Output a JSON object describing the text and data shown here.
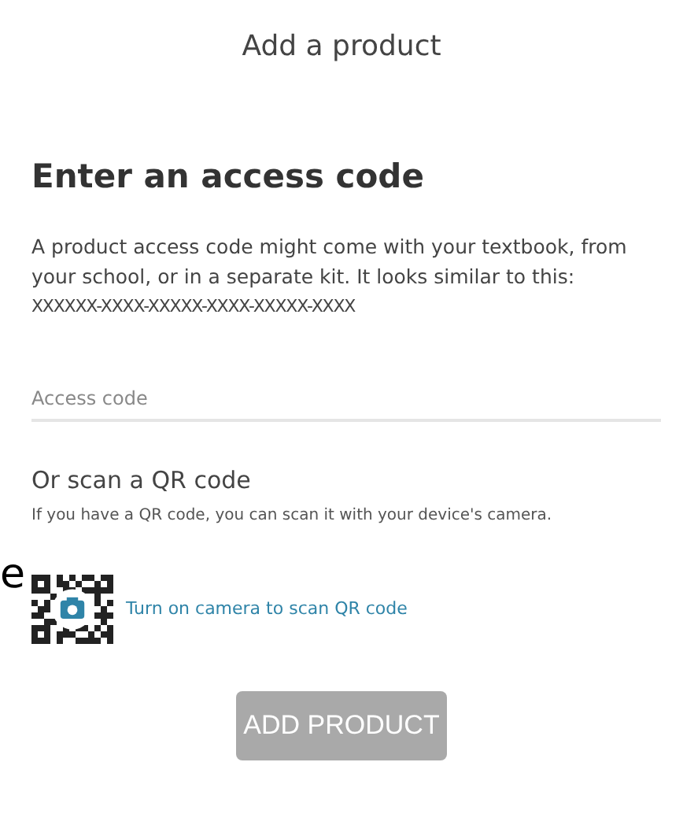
{
  "title": "Add a product",
  "heading": "Enter an access code",
  "description": "A product access code might come with your textbook, from your school, or in a separate kit. It looks similar to this:",
  "code_format": "XXXXXX-XXXX-XXXXX-XXXX-XXXXX-XXXX",
  "access_code_field": {
    "placeholder": "Access code"
  },
  "qr_section": {
    "heading": "Or scan a QR code",
    "description": "If you have a QR code, you can scan it with your device's camera.",
    "link": "Turn on camera to scan QR code"
  },
  "edge_fragment": "e",
  "add_button": {
    "label": "ADD PRODUCT",
    "disabled": true
  }
}
